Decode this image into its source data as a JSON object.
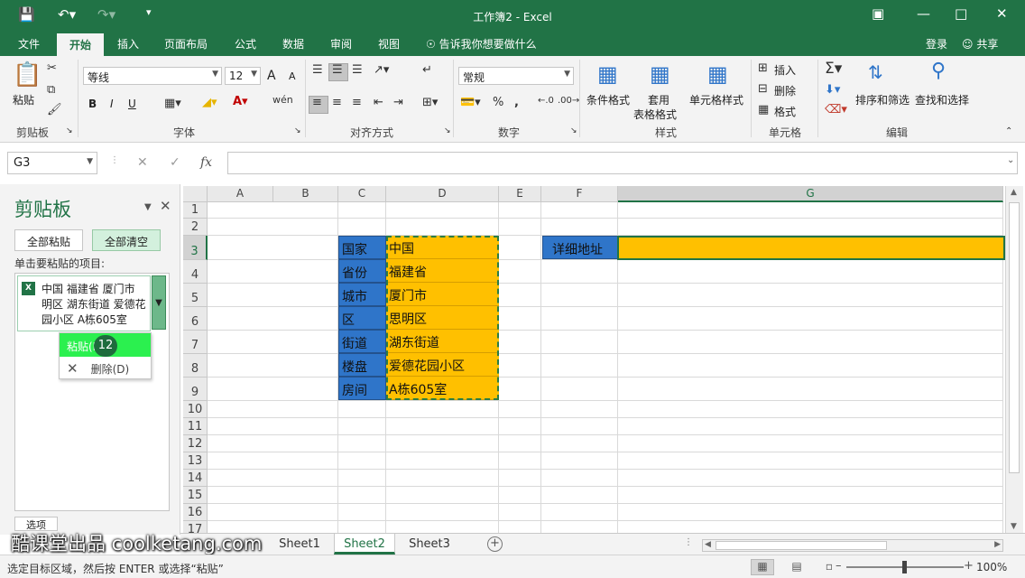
{
  "window": {
    "title": "工作簿2 - Excel",
    "qa_icons": [
      "save-icon",
      "undo-icon",
      "redo-icon",
      "customize-icon"
    ],
    "controls": [
      "restore-ribbon-icon",
      "minimize-icon",
      "maximize-icon",
      "close-icon"
    ]
  },
  "menu": {
    "tabs": [
      "文件",
      "开始",
      "插入",
      "页面布局",
      "公式",
      "数据",
      "审阅",
      "视图"
    ],
    "active_tab": "开始",
    "tell_me": "告诉我你想要做什么",
    "login": "登录",
    "share": "共享"
  },
  "ribbon": {
    "clipboard": {
      "paste": "粘贴",
      "label": "剪贴板"
    },
    "font": {
      "name": "等线",
      "size": "12",
      "bold": "B",
      "italic": "I",
      "underline": "U",
      "grow": "A",
      "shrink": "A",
      "label": "字体"
    },
    "alignment": {
      "label": "对齐方式"
    },
    "number": {
      "format": "常规",
      "label": "数字"
    },
    "styles": {
      "conditional": "条件格式",
      "table1": "套用",
      "table2": "表格格式",
      "cell_styles": "单元格样式",
      "label": "样式"
    },
    "cells": {
      "insert": "插入",
      "delete": "删除",
      "format": "格式",
      "label": "单元格"
    },
    "editing": {
      "sort": "排序和筛选",
      "find": "查找和选择",
      "label": "编辑"
    }
  },
  "formula_bar": {
    "name_box": "G3",
    "fx": "fx",
    "value": ""
  },
  "clipboard_pane": {
    "title": "剪贴板",
    "paste_all": "全部粘贴",
    "clear_all": "全部清空",
    "hint": "单击要粘贴的项目:",
    "item_lines": [
      "中国 福建省 厦门市",
      "明区 湖东街道 爱德花",
      "园小区 A栋605室"
    ],
    "menu_paste": "粘贴(P)",
    "menu_delete": "删除(D)",
    "step_badge": "12",
    "options": "选项"
  },
  "grid": {
    "columns": [
      "A",
      "B",
      "C",
      "D",
      "E",
      "F",
      "G"
    ],
    "selected_column": "G",
    "rows": [
      "1",
      "2",
      "3",
      "4",
      "5",
      "6",
      "7",
      "8",
      "9",
      "10",
      "11",
      "12",
      "13",
      "14",
      "15",
      "16",
      "17"
    ],
    "selected_row": "3",
    "labels": [
      "国家",
      "省份",
      "城市",
      "区",
      "街道",
      "楼盘",
      "房间"
    ],
    "values": [
      "中国",
      "福建省",
      "厦门市",
      "思明区",
      "湖东街道",
      "爱德花园小区",
      "A栋605室"
    ],
    "f3": "详细地址",
    "colors": {
      "label_fill": "#2f75c9",
      "value_fill": "#ffc000",
      "accent": "#217346"
    }
  },
  "sheets": {
    "tabs": [
      "Sheet1",
      "Sheet2",
      "Sheet3"
    ],
    "active": "Sheet2"
  },
  "watermark": "酷课堂出品 coolketang.com",
  "status": {
    "text": "选定目标区域，然后按 ENTER 或选择“粘贴”",
    "zoom": "100%"
  }
}
